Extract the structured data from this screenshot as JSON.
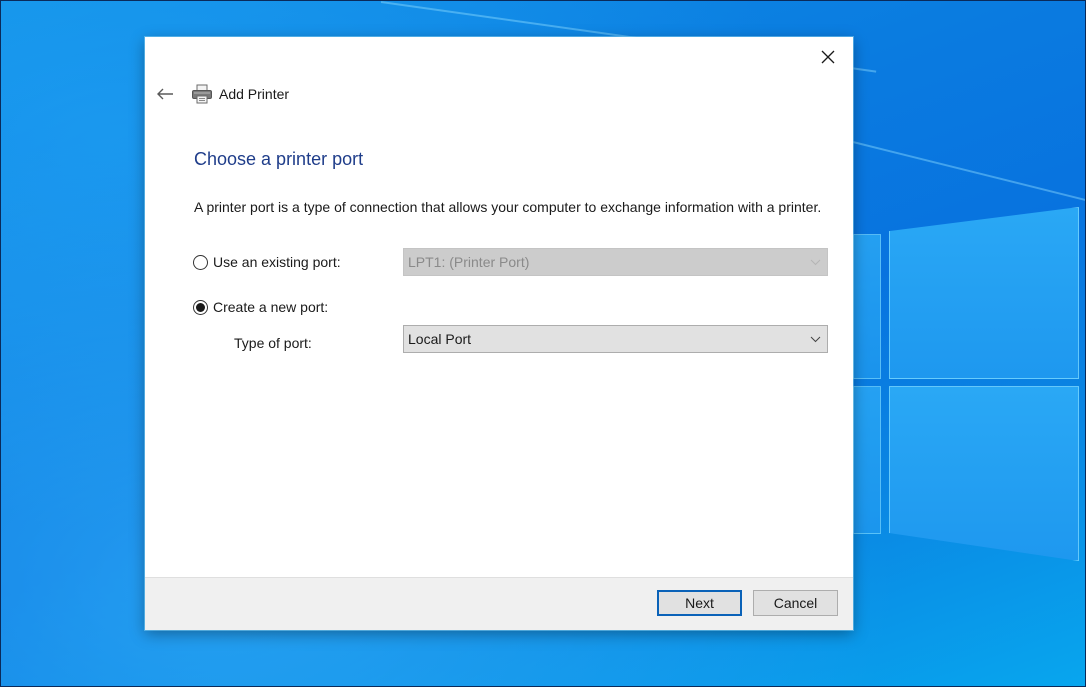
{
  "window": {
    "title": "Add Printer",
    "close_label": "Close",
    "back_label": "Back"
  },
  "page": {
    "heading": "Choose a printer port",
    "description": "A printer port is a type of connection that allows your computer to exchange information with a printer."
  },
  "options": {
    "existing": {
      "label": "Use an existing port:",
      "selected": false,
      "dropdown_value": "LPT1: (Printer Port)",
      "dropdown_enabled": false
    },
    "new": {
      "label": "Create a new port:",
      "selected": true,
      "type_label": "Type of port:",
      "dropdown_value": "Local Port",
      "dropdown_enabled": true
    }
  },
  "footer": {
    "next_label": "Next",
    "cancel_label": "Cancel"
  },
  "icons": {
    "close": "close-icon",
    "back": "arrow-left-icon",
    "printer": "printer-icon",
    "chevron": "chevron-down-icon"
  },
  "colors": {
    "heading": "#1f3d8a",
    "primary_border": "#0a62b8",
    "desktop": "#0a7be0"
  }
}
